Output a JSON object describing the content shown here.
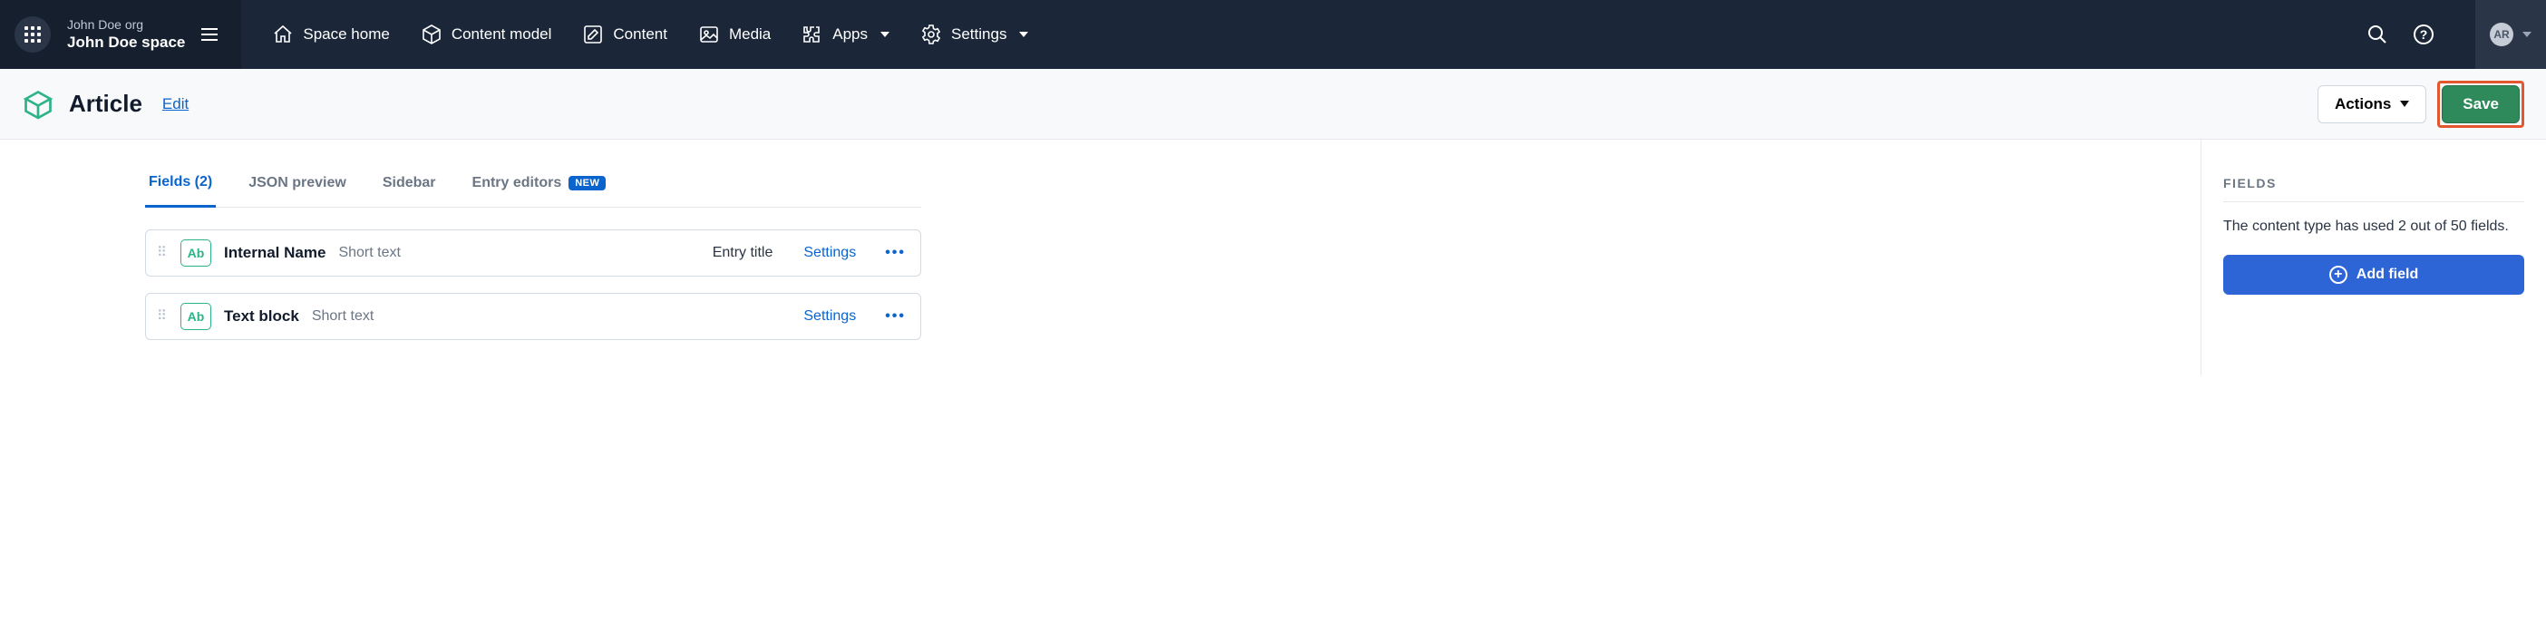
{
  "header": {
    "org": "John Doe org",
    "space": "John Doe space",
    "nav": {
      "home": "Space home",
      "model": "Content model",
      "content": "Content",
      "media": "Media",
      "apps": "Apps",
      "settings": "Settings"
    },
    "avatar": "AR"
  },
  "page": {
    "title": "Article",
    "edit": "Edit",
    "actions": "Actions",
    "save": "Save"
  },
  "tabs": {
    "fields": "Fields (2)",
    "json": "JSON preview",
    "sidebar": "Sidebar",
    "editors": "Entry editors",
    "new_badge": "NEW"
  },
  "fields": [
    {
      "badge": "Ab",
      "name": "Internal Name",
      "type": "Short text",
      "entry_title": "Entry title",
      "settings": "Settings"
    },
    {
      "badge": "Ab",
      "name": "Text block",
      "type": "Short text",
      "entry_title": "",
      "settings": "Settings"
    }
  ],
  "side": {
    "heading": "FIELDS",
    "text": "The content type has used 2 out of 50 fields.",
    "add": "Add field"
  }
}
